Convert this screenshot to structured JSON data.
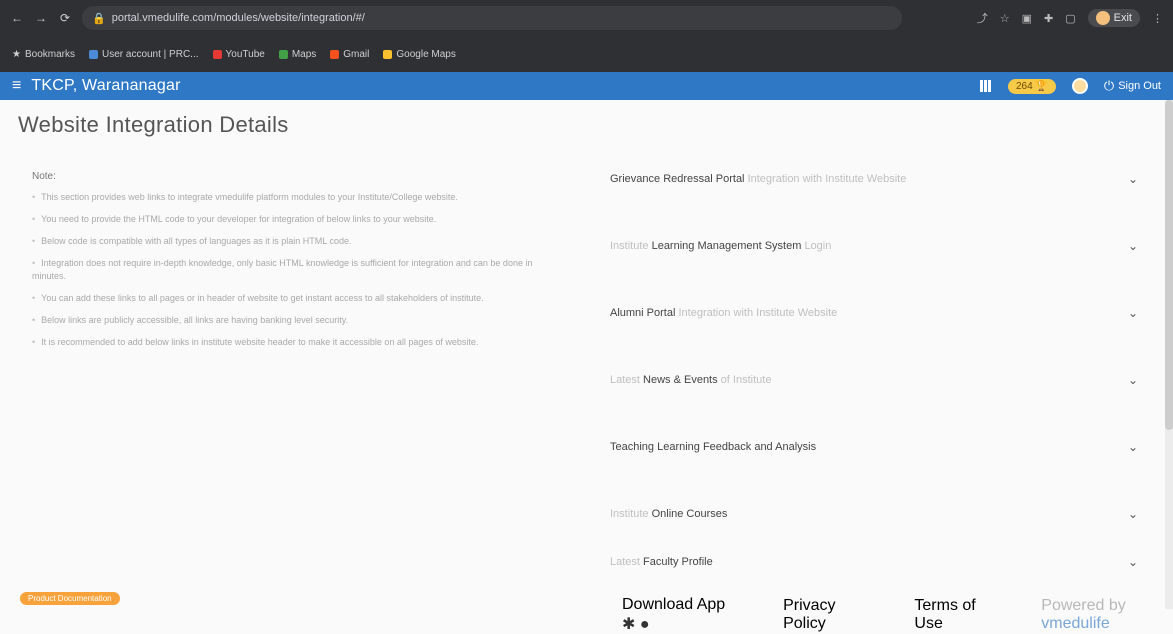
{
  "browser": {
    "url": "portal.vmedulife.com/modules/website/integration/#/",
    "profile_label": "Exit",
    "bookmarks": [
      "Bookmarks",
      "User account | PRC...",
      "YouTube",
      "Maps",
      "Gmail",
      "Google Maps"
    ]
  },
  "app": {
    "title": "TKCP, Warananagar",
    "points_badge": "264",
    "sign_out_label": "Sign Out"
  },
  "page": {
    "title": "Website Integration Details"
  },
  "note": {
    "heading": "Note:",
    "items": [
      "This section provides web links to integrate vmedulife platform modules to your Institute/College website.",
      "You need to provide the HTML code to your developer for integration of below links to your website.",
      "Below code is compatible with all types of languages as it is plain HTML code.",
      "Integration does not require in-depth knowledge, only basic HTML knowledge is sufficient for integration and can be done in minutes.",
      "You can add these links to all pages or in header of website to get instant access to all stakeholders of institute.",
      "Below links are publicly accessible, all links are having banking level security.",
      "It is recommended to add below links in institute website header to make it accessible on all pages of website."
    ]
  },
  "accordion": [
    {
      "pre": "",
      "bold": "Grievance Redressal Portal",
      "post": " Integration with Institute Website"
    },
    {
      "pre": "Institute ",
      "bold": "Learning Management System",
      "post": " Login"
    },
    {
      "pre": "",
      "bold": "Alumni Portal",
      "post": " Integration with Institute Website"
    },
    {
      "pre": "Latest ",
      "bold": "News & Events",
      "post": " of Institute"
    },
    {
      "pre": "",
      "bold": "Teaching Learning Feedback and Analysis",
      "post": ""
    },
    {
      "pre": "Institute ",
      "bold": "Online Courses",
      "post": ""
    },
    {
      "pre": "Latest ",
      "bold": "Faculty Profile",
      "post": ""
    }
  ],
  "footer": {
    "doc_badge": "Product Documentation",
    "download_app": "Download App",
    "privacy": "Privacy Policy",
    "terms": "Terms of Use",
    "powered_pre": "Powered by ",
    "powered_brand": "vmedulife"
  }
}
